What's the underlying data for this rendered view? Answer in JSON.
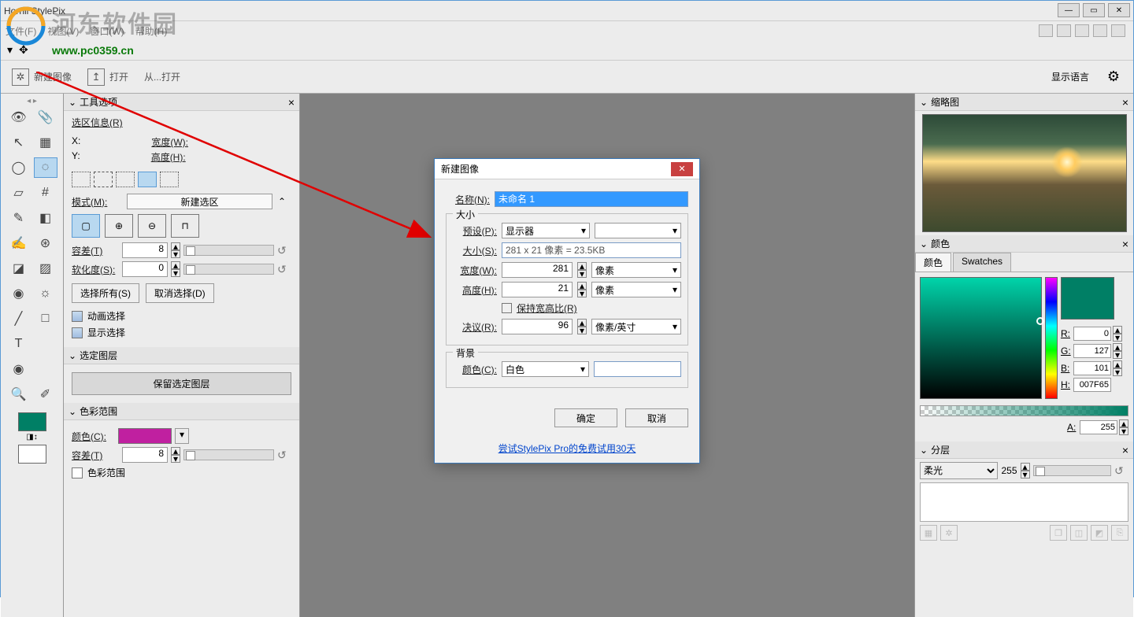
{
  "app_title": "Hornil StylePix",
  "menubar": {
    "file": "文件(F)",
    "view": "视图(V)",
    "window": "窗口(W)",
    "help": "帮助(H)"
  },
  "watermark_cn": "河东软件园",
  "watermark_url": "www.pc0359.cn",
  "toolbar2": {
    "new_image": "新建图像",
    "open": "打开",
    "open_from": "从...打开",
    "display_lang": "显示语言"
  },
  "tool_options": {
    "title": "工具选项",
    "selection_info": "选区信息(R)",
    "x": "X:",
    "y": "Y:",
    "width": "宽度(W):",
    "height": "高度(H):",
    "mode_label": "模式(M):",
    "mode_value": "新建选区",
    "tolerance_label": "容差(T)",
    "tolerance_value": "8",
    "feather_label": "软化度(S):",
    "feather_value": "0",
    "select_all": "选择所有(S)",
    "deselect": "取消选择(D)",
    "anim_select": "动画选择",
    "show_select": "显示选择"
  },
  "selected_layers": {
    "title": "选定图层",
    "keep_btn": "保留选定图层"
  },
  "color_range": {
    "title": "色彩范围",
    "color_label": "颜色(C):",
    "tolerance_label": "容差(T)",
    "tolerance_value": "8",
    "cb_label": "色彩范围"
  },
  "dialog": {
    "title": "新建图像",
    "name_label": "名称(N):",
    "name_value": "未命名 1",
    "size_legend": "大小",
    "preset_label": "预设(P):",
    "preset_value": "显示器",
    "size_label": "大小(S):",
    "size_value": "281 x 21 像素 = 23.5KB",
    "width_label": "宽度(W):",
    "width_value": "281",
    "width_unit": "像素",
    "height_label": "高度(H):",
    "height_value": "21",
    "height_unit": "像素",
    "aspect_label": "保持宽高比(R)",
    "resolution_label": "决议(R):",
    "resolution_value": "96",
    "resolution_unit": "像素/英寸",
    "bg_legend": "背景",
    "color_label": "颜色(C):",
    "color_value": "白色",
    "ok": "确定",
    "cancel": "取消",
    "trial": "尝试StylePix Pro的免费试用30天"
  },
  "thumbnail": {
    "title": "缩略图"
  },
  "color_panel": {
    "title": "颜色",
    "tab_color": "颜色",
    "tab_swatches": "Swatches",
    "r_label": "R:",
    "g_label": "G:",
    "b_label": "B:",
    "h_label": "H:",
    "a_label": "A:",
    "r": "0",
    "g": "127",
    "b": "101",
    "h": "007F65",
    "a": "255"
  },
  "layers": {
    "title": "分层",
    "blend": "柔光",
    "opacity": "255"
  }
}
